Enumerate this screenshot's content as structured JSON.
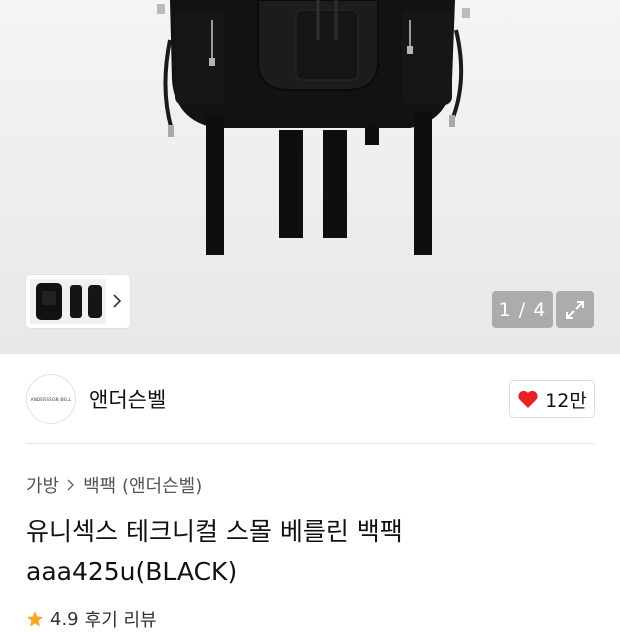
{
  "gallery": {
    "counter": "1 / 4",
    "icons": {
      "expand": "expand-arrows-icon",
      "next": "chevron-right-icon"
    }
  },
  "brand": {
    "logo_text": "ANDERSSON BELL",
    "name": "앤더슨벨",
    "like_count": "12만",
    "like_icon": "heart-icon",
    "like_color": "#e8202a"
  },
  "breadcrumb": {
    "items": [
      "가방",
      "백팩 (앤더슨벨)"
    ]
  },
  "product": {
    "title": "유니섹스 테크니컬 스몰 베를린 백팩 aaa425u(BLACK)"
  },
  "rating": {
    "score": "4.9",
    "review_label": "후기 리뷰",
    "star_color": "#f5a623"
  }
}
